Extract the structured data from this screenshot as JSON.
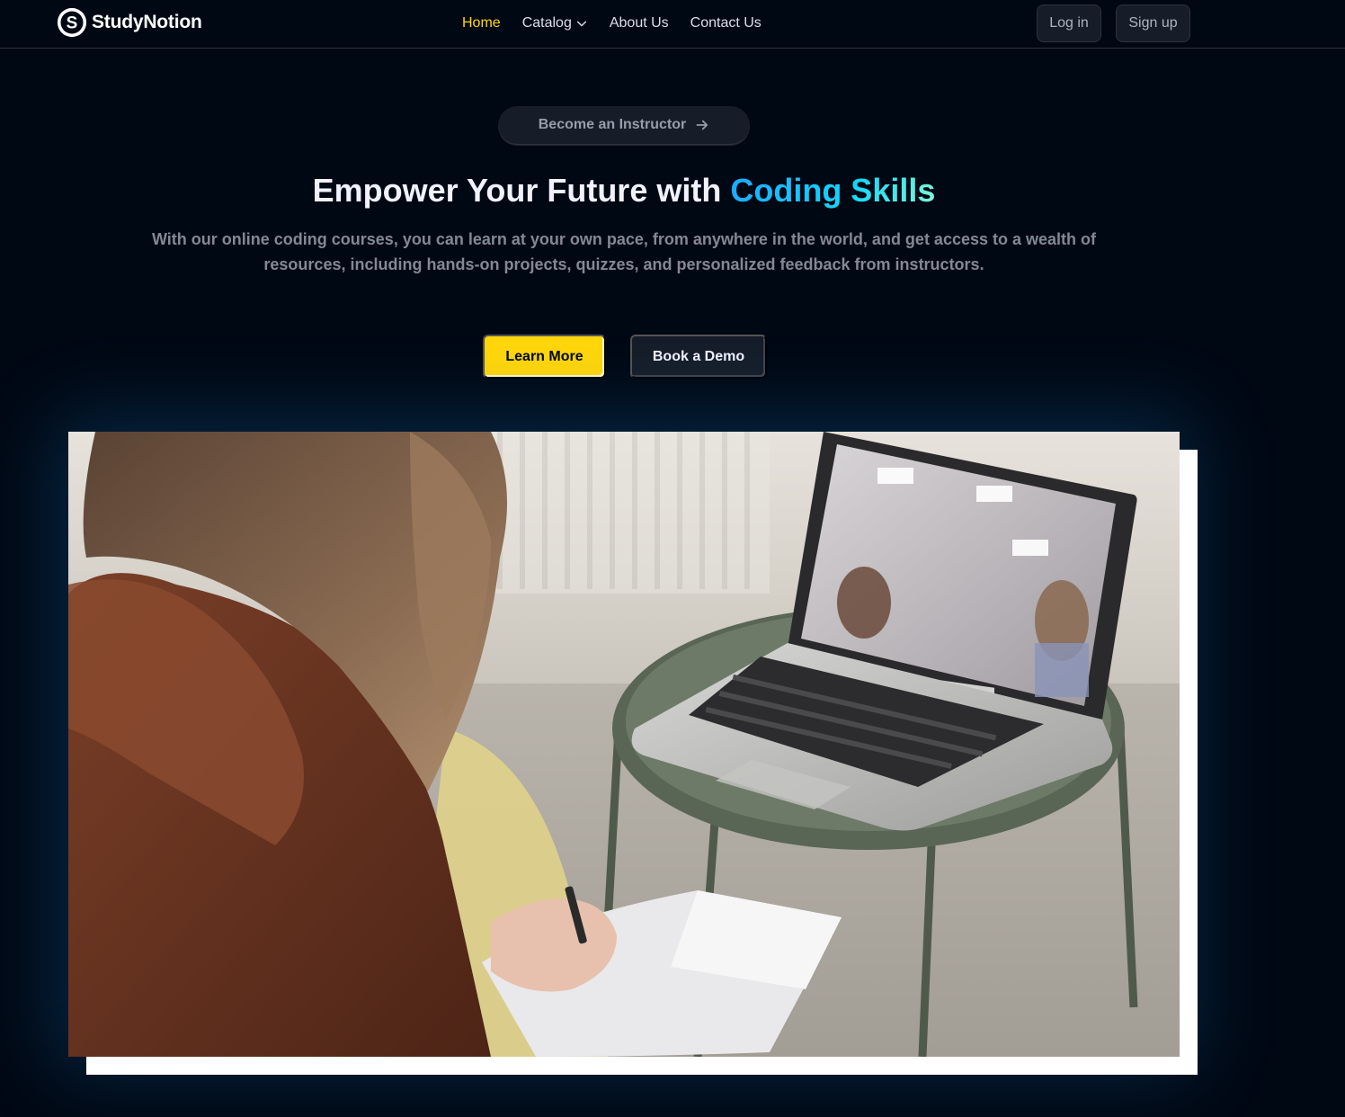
{
  "brand": {
    "name": "StudyNotion",
    "logo_letter": "S"
  },
  "nav": {
    "items": [
      {
        "label": "Home",
        "active": true
      },
      {
        "label": "Catalog",
        "has_dropdown": true
      },
      {
        "label": "About Us"
      },
      {
        "label": "Contact Us"
      }
    ]
  },
  "auth": {
    "login_label": "Log in",
    "signup_label": "Sign up"
  },
  "hero": {
    "pill_label": "Become an Instructor",
    "title_prefix": "Empower Your Future with",
    "title_highlight": "Coding Skills",
    "subtitle": "With our online coding courses, you can learn at your own pace, from anywhere in the world, and get access to a wealth of resources, including hands-on projects, quizzes, and personalized feedback from instructors.",
    "cta_primary": "Learn More",
    "cta_secondary": "Book a Demo"
  },
  "media": {
    "type": "video",
    "icon": "hero-video"
  },
  "colors": {
    "background": "#000814",
    "accent_yellow": "#FFD60A",
    "nav_text": "#DBDDEA",
    "gradient": [
      "#1FA2FF",
      "#12D8FA",
      "#A6FFCB"
    ]
  }
}
